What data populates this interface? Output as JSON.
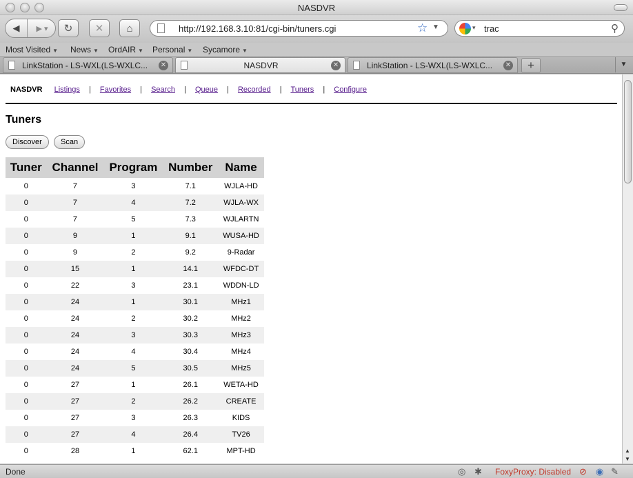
{
  "window": {
    "title": "NASDVR"
  },
  "toolbar": {
    "url": "http://192.168.3.10:81/cgi-bin/tuners.cgi",
    "search_query": "trac"
  },
  "bookmarks": [
    "Most Visited",
    "News",
    "OrdAIR",
    "Personal",
    "Sycamore"
  ],
  "tabs": [
    {
      "label": "LinkStation - LS-WXL(LS-WXLC..."
    },
    {
      "label": "NASDVR"
    },
    {
      "label": "LinkStation - LS-WXL(LS-WXLC..."
    }
  ],
  "site_nav": {
    "brand": "NASDVR",
    "links": [
      "Listings",
      "Favorites",
      "Search",
      "Queue",
      "Recorded",
      "Tuners",
      "Configure"
    ],
    "separator": "|"
  },
  "page": {
    "heading": "Tuners",
    "discover_label": "Discover",
    "scan_label": "Scan"
  },
  "table": {
    "headers": [
      "Tuner",
      "Channel",
      "Program",
      "Number",
      "Name"
    ],
    "rows": [
      [
        "0",
        "7",
        "3",
        "7.1",
        "WJLA-HD"
      ],
      [
        "0",
        "7",
        "4",
        "7.2",
        "WJLA-WX"
      ],
      [
        "0",
        "7",
        "5",
        "7.3",
        "WJLARTN"
      ],
      [
        "0",
        "9",
        "1",
        "9.1",
        "WUSA-HD"
      ],
      [
        "0",
        "9",
        "2",
        "9.2",
        "9-Radar"
      ],
      [
        "0",
        "15",
        "1",
        "14.1",
        "WFDC-DT"
      ],
      [
        "0",
        "22",
        "3",
        "23.1",
        "WDDN-LD"
      ],
      [
        "0",
        "24",
        "1",
        "30.1",
        "MHz1"
      ],
      [
        "0",
        "24",
        "2",
        "30.2",
        "MHz2"
      ],
      [
        "0",
        "24",
        "3",
        "30.3",
        "MHz3"
      ],
      [
        "0",
        "24",
        "4",
        "30.4",
        "MHz4"
      ],
      [
        "0",
        "24",
        "5",
        "30.5",
        "MHz5"
      ],
      [
        "0",
        "27",
        "1",
        "26.1",
        "WETA-HD"
      ],
      [
        "0",
        "27",
        "2",
        "26.2",
        "CREATE"
      ],
      [
        "0",
        "27",
        "3",
        "26.3",
        "KIDS"
      ],
      [
        "0",
        "27",
        "4",
        "26.4",
        "TV26"
      ],
      [
        "0",
        "28",
        "1",
        "62.1",
        "MPT-HD"
      ]
    ]
  },
  "status": {
    "text": "Done",
    "foxyproxy": "FoxyProxy: Disabled"
  },
  "icons": {
    "back": "back-arrow-icon",
    "forward": "forward-arrow-icon",
    "reload": "reload-icon",
    "stop": "stop-icon",
    "home": "home-icon",
    "bookmark_star": "star-icon",
    "search_engine": "google-icon",
    "search": "magnifier-icon"
  }
}
